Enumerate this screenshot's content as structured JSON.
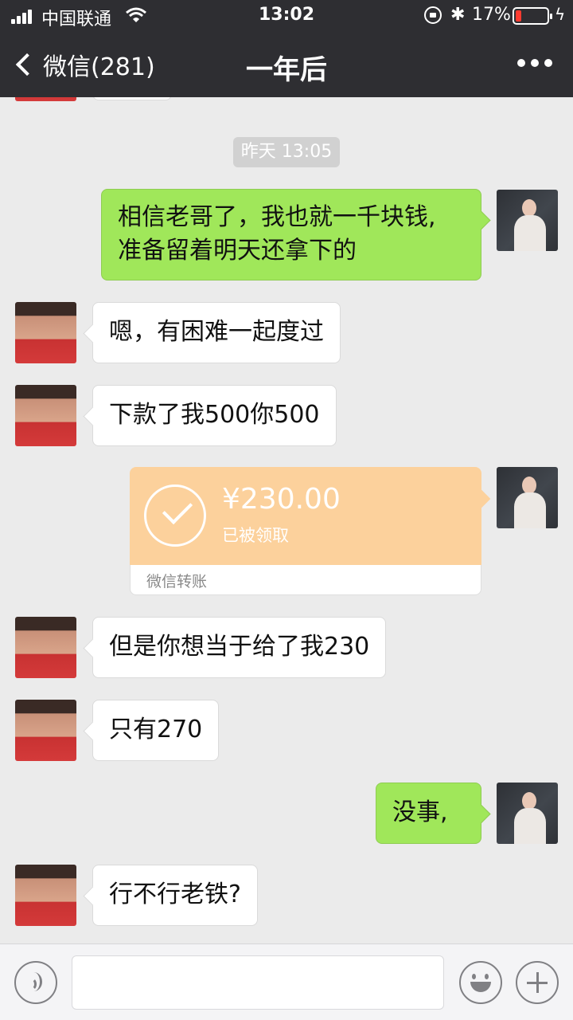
{
  "status_bar": {
    "carrier": "中国联通",
    "time": "13:02",
    "battery_percent": "17%",
    "battery_level": 0.17,
    "bluetooth_glyph": "✱",
    "charging_glyph": "ϟ"
  },
  "nav": {
    "back_label": "微信(281)",
    "title": "一年后"
  },
  "chat": {
    "timestamp": "昨天 13:05",
    "messages": [
      {
        "side": "out",
        "line1": "相信老哥了，我也就一千块钱,",
        "line2": "准备留着明天还拿下的"
      },
      {
        "side": "in",
        "text": "嗯，有困难一起度过"
      },
      {
        "side": "in",
        "text": "下款了我500你500"
      },
      {
        "side": "in",
        "text": "但是你想当于给了我230"
      },
      {
        "side": "in",
        "text": "只有270"
      },
      {
        "side": "out",
        "text": "没事,"
      },
      {
        "side": "in",
        "text": "行不行老铁?"
      }
    ],
    "transfer": {
      "amount": "¥230.00",
      "status": "已被领取",
      "label": "微信转账"
    }
  },
  "input": {
    "placeholder": ""
  },
  "colors": {
    "header_bg": "#2e2e32",
    "chat_bg": "#ebebeb",
    "out_bubble": "#a0e75a",
    "transfer_bg": "#fcd19c",
    "timestamp_bg": "#d1d1d1"
  }
}
